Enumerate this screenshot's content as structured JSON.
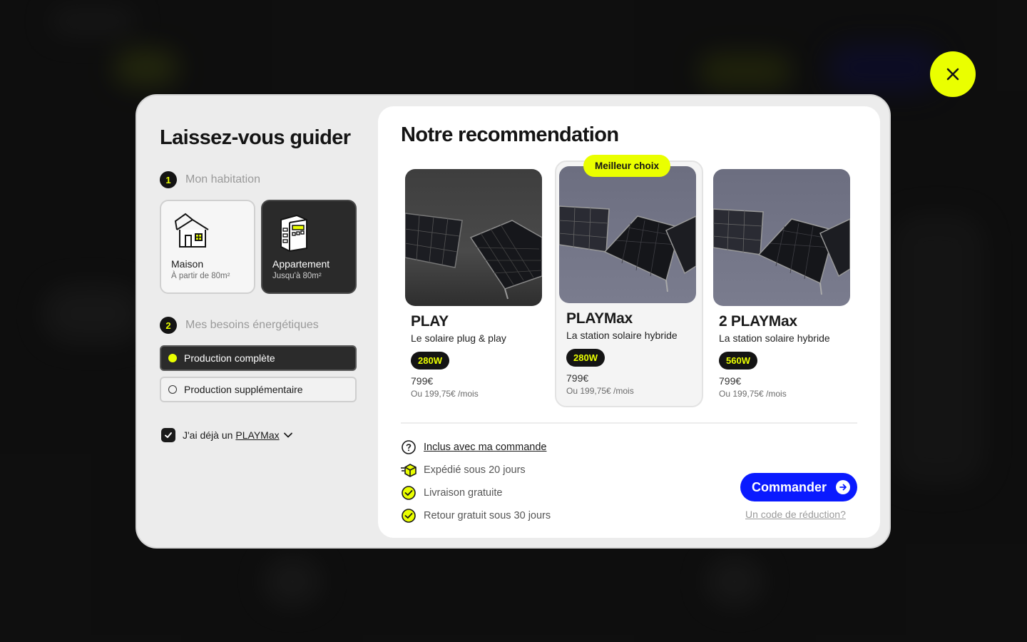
{
  "colors": {
    "accent_yellow": "#eaff00",
    "primary_blue": "#0a1aff",
    "dark": "#141414",
    "modal_bg": "#ececec"
  },
  "close": {
    "icon": "close-icon"
  },
  "guide": {
    "title": "Laissez-vous guider",
    "step1": {
      "number": "1",
      "label": "Mon habitation"
    },
    "housing": [
      {
        "name": "Maison",
        "sub": "À partir de 80m²",
        "icon": "house-icon",
        "selected": false
      },
      {
        "name": "Appartement",
        "sub": "Jusqu'à 80m²",
        "icon": "building-icon",
        "selected": true
      }
    ],
    "step2": {
      "number": "2",
      "label": "Mes besoins énergétiques"
    },
    "needs": [
      {
        "label": "Production complète",
        "selected": true
      },
      {
        "label": "Production supplémentaire",
        "selected": false
      }
    ],
    "owned": {
      "prefix": "J'ai déjà un",
      "product": "PLAYMax",
      "checked": true
    }
  },
  "recommendation": {
    "title": "Notre recommendation",
    "best_badge": "Meilleur choix",
    "products": [
      {
        "name": "PLAY",
        "tagline": "Le solaire plug & play",
        "power": "280W",
        "price": "799€",
        "monthly": "Ou 199,75€ /mois"
      },
      {
        "name": "PLAYMax",
        "tagline": "La station solaire hybride",
        "power": "280W",
        "price": "799€",
        "monthly": "Ou 199,75€ /mois"
      },
      {
        "name": "2 PLAYMax",
        "tagline": "La station solaire hybride",
        "power": "560W",
        "price": "799€",
        "monthly": "Ou 199,75€ /mois"
      }
    ],
    "included": {
      "heading": "Inclus avec ma commande",
      "items": [
        {
          "label": "Expédié sous 20 jours",
          "icon": "shipping-box-icon"
        },
        {
          "label": "Livraison gratuite",
          "icon": "check-circle-icon"
        },
        {
          "label": "Retour gratuit sous 30 jours",
          "icon": "check-circle-icon"
        }
      ]
    },
    "order_label": "Commander",
    "promo_label": "Un code de réduction?"
  }
}
